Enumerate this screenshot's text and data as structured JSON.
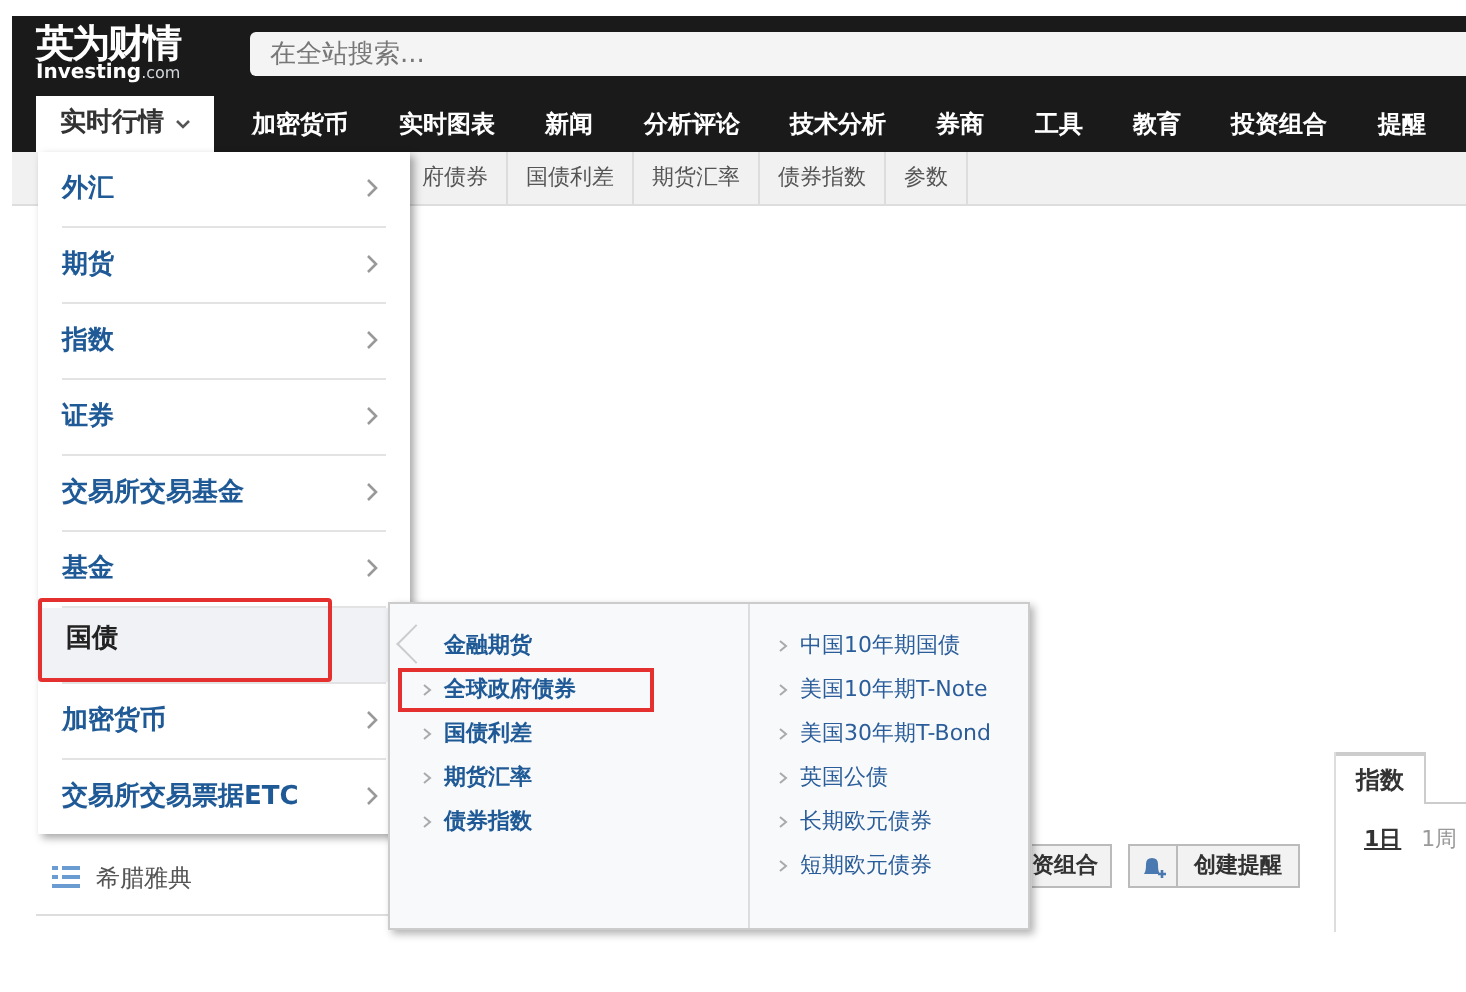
{
  "logo": {
    "title": "英为财情",
    "subtitle": "Investing",
    "suffix": ".com"
  },
  "search": {
    "placeholder": "在全站搜索..."
  },
  "nav": [
    {
      "label": "实时行情",
      "selected": true,
      "caret": true
    },
    {
      "label": "加密货币",
      "selected": false
    },
    {
      "label": "实时图表",
      "selected": false
    },
    {
      "label": "新闻",
      "selected": false
    },
    {
      "label": "分析评论",
      "selected": false
    },
    {
      "label": "技术分析",
      "selected": false
    },
    {
      "label": "券商",
      "selected": false
    },
    {
      "label": "工具",
      "selected": false
    },
    {
      "label": "教育",
      "selected": false
    },
    {
      "label": "投资组合",
      "selected": false
    },
    {
      "label": "提醒",
      "selected": false
    }
  ],
  "subnav": [
    "府债券",
    "国债利差",
    "期货汇率",
    "债券指数",
    "参数"
  ],
  "dropdown": [
    {
      "label": "外汇",
      "selected": false
    },
    {
      "label": "期货",
      "selected": false
    },
    {
      "label": "指数",
      "selected": false
    },
    {
      "label": "证券",
      "selected": false
    },
    {
      "label": "交易所交易基金",
      "selected": false
    },
    {
      "label": "基金",
      "selected": false
    },
    {
      "label": "国债",
      "selected": true
    },
    {
      "label": "加密货币",
      "selected": false
    },
    {
      "label": "交易所交易票据ETC",
      "selected": false
    }
  ],
  "submenu": {
    "left": [
      {
        "label": "金融期货",
        "highlighted": false
      },
      {
        "label": "全球政府债券",
        "highlighted": true
      },
      {
        "label": "国债利差",
        "highlighted": false
      },
      {
        "label": "期货汇率",
        "highlighted": false
      },
      {
        "label": "债券指数",
        "highlighted": false
      }
    ],
    "right": [
      "中国10年期国债",
      "美国10年期T-Note",
      "美国30年期T-Bond",
      "英国公债",
      "长期欧元债券",
      "短期欧元债券"
    ]
  },
  "page": {
    "list_item": "希腊雅典",
    "buttons": [
      {
        "label": "资组合",
        "kind": "plain"
      },
      {
        "label": "创建提醒",
        "kind": "bell"
      }
    ],
    "tab": "指数",
    "periods": [
      {
        "label": "1日",
        "selected": true
      },
      {
        "label": "1周",
        "selected": false
      }
    ]
  }
}
